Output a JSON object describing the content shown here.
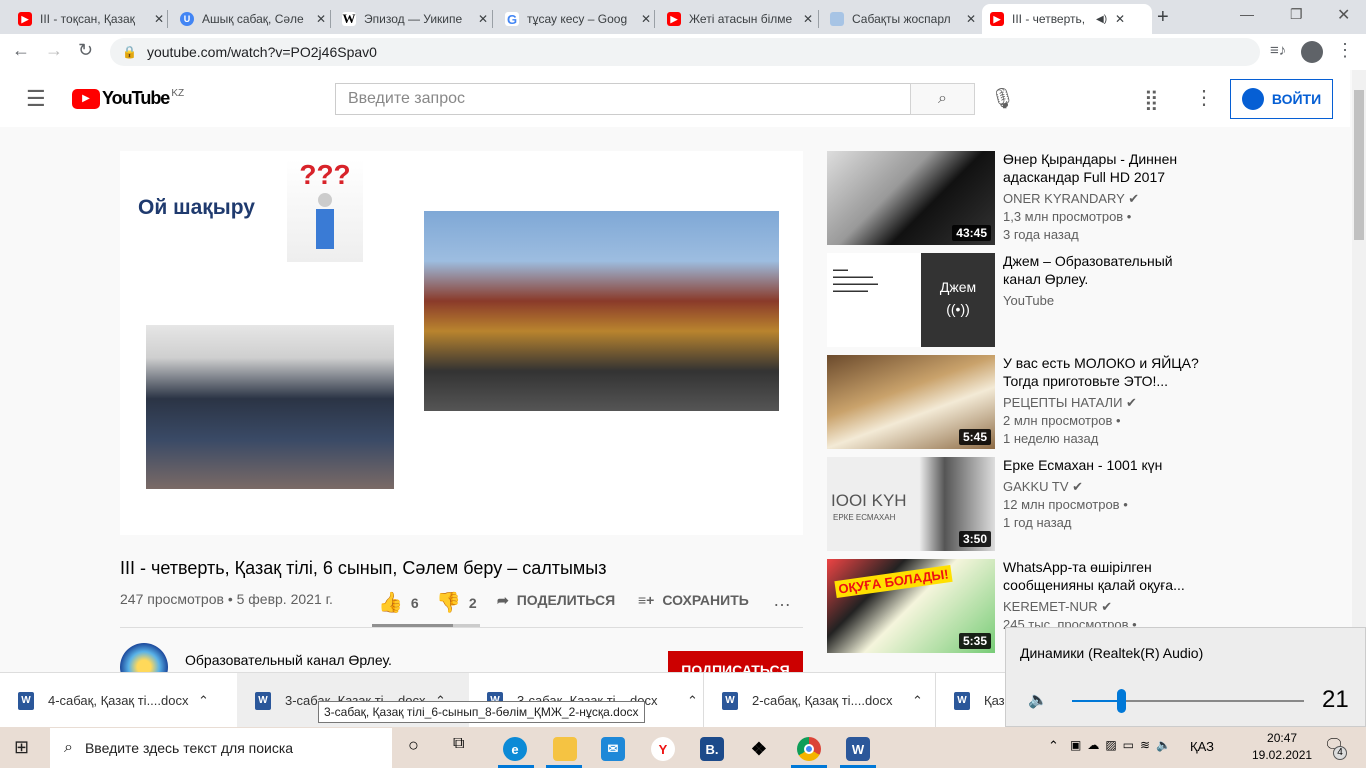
{
  "browser": {
    "tabs": [
      {
        "title": "III - тоқсан, Қазақ",
        "icon": "youtube-icon"
      },
      {
        "title": "Ашық сабақ, Сәле",
        "icon": "u-icon"
      },
      {
        "title": "Эпизод — Уикипе",
        "icon": "wikipedia-icon"
      },
      {
        "title": "тұсау кесу – Goog",
        "icon": "google-icon"
      },
      {
        "title": "Жеті атасын білме",
        "icon": "youtube-icon"
      },
      {
        "title": "Сабақты жоспарл",
        "icon": "document-icon"
      },
      {
        "title": "III - четверть,",
        "icon": "youtube-icon",
        "active": true
      }
    ],
    "url": "youtube.com/watch?v=PO2j46Spav0"
  },
  "header": {
    "logo": "YouTube",
    "region": "KZ",
    "search_placeholder": "Введите запрос",
    "login_label": "ВОЙТИ"
  },
  "slide": {
    "heading": "Ой шақыру"
  },
  "video": {
    "title": "III - четверть, Қазақ тілі, 6 сынып, Сәлем беру – салтымыз",
    "views": "247 просмотров • 5 февр. 2021 г.",
    "likes": "6",
    "dislikes": "2",
    "share_label": "ПОДЕЛИТЬСЯ",
    "save_label": "СОХРАНИТЬ",
    "like_ratio": 0.75,
    "channel": "Образовательный канал Өрлеу.",
    "subscribe_label": "ПОДПИСАТЬСЯ"
  },
  "related": [
    {
      "title": "Өнер Қырандары - Диннен адаскандар Full HD 2017",
      "channel": "ONER KYRANDARY",
      "views": "1,3 млн просмотров •",
      "age": "3 года назад",
      "duration": "43:45"
    },
    {
      "title": "Джем – Образовательный канал Өрлеу.",
      "channel": "YouTube",
      "overlay": "Джем"
    },
    {
      "title": "У вас есть МОЛОКО и ЯЙЦА? Тогда приготовьте ЭТО!...",
      "channel": "РЕЦЕПТЫ НАТАЛИ",
      "views": "2 млн просмотров •",
      "age": "1 неделю назад",
      "duration": "5:45"
    },
    {
      "title": "Ерке Есмахан - 1001 күн",
      "channel": "GAKKU TV",
      "views": "12 млн просмотров •",
      "age": "1 год назад",
      "duration": "3:50",
      "thumb_text": "IOOI KYH",
      "thumb_sub": "ЕРКЕ ЕСМАХАН"
    },
    {
      "title": "WhatsApp-та өшірілген сообщенияны қалай оқуға...",
      "channel": "KEREMET-NUR",
      "views": "245 тыс. просмотров •",
      "duration": "5:35",
      "thumb_text": "ОҚУҒА БОЛАДЫ!"
    }
  ],
  "downloads": [
    {
      "name": "4-сабақ, Қазақ ті....docx"
    },
    {
      "name": "3-сабақ, Қазақ ті....docx"
    },
    {
      "name": "3-сабақ, Қазақ ті....docx"
    },
    {
      "name": "2-сабақ, Қазақ ті....docx"
    },
    {
      "name": "Қаза"
    }
  ],
  "tooltip": "3-сабақ, Қазақ тілі_6-сынып_8-бөлім_ҚМЖ_2-нұсқа.docx",
  "volume": {
    "device": "Динамики (Realtek(R) Audio)",
    "level": 21
  },
  "taskbar": {
    "search_placeholder": "Введите здесь текст для поиска",
    "lang": "ҚАЗ",
    "time": "20:47",
    "date": "19.02.2021",
    "notifications": "4"
  }
}
